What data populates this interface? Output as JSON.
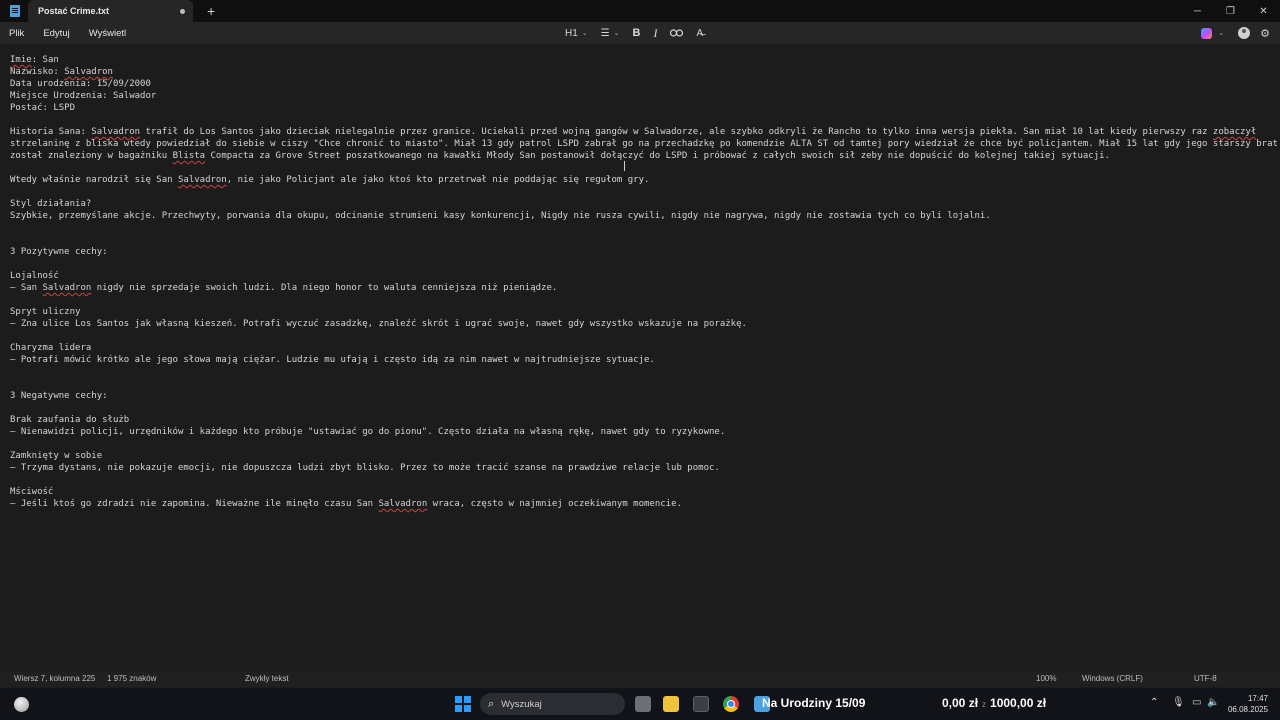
{
  "window": {
    "tab_title": "Postać Crime.txt",
    "new_tab": "+",
    "controls": [
      "─",
      "❐",
      "✕"
    ]
  },
  "menu": {
    "items": [
      "Plik",
      "Edytuj",
      "Wyświetl"
    ]
  },
  "toolbar": {
    "heading": "H1",
    "list": "☰",
    "bold": "B",
    "italic": "I",
    "link": "🔗",
    "clear_format": "A̶"
  },
  "document": {
    "lines": [
      [
        {
          "t": "Imie",
          "s": true
        },
        {
          "t": ": San"
        }
      ],
      [
        {
          "t": "Nazwisko: "
        },
        {
          "t": "Salvadron",
          "s": true
        }
      ],
      [
        {
          "t": "Data urodzenia: 15/09/2000"
        }
      ],
      [
        {
          "t": "Miejsce Urodzenia: Salwador"
        }
      ],
      [
        {
          "t": "Postać: LSPD"
        }
      ],
      [],
      [
        {
          "t": "Historia Sana: "
        },
        {
          "t": "Salvadron",
          "s": true
        },
        {
          "t": " trafił do Los Santos jako dzieciak nielegalnie przez granice. Uciekali przed wojną gangów w Salwadorze, ale szybko odkryli że Rancho to tylko inna wersja piekła. San miał 10 lat kiedy pierwszy raz "
        },
        {
          "t": "zobaczył",
          "s": true
        }
      ],
      [
        {
          "t": "strzelaninę z bliska wtedy powiedział do siebie w ciszy \"Chce chronić to miasto\". Miał 13 gdy patrol LSPD zabrał go na przechadzkę po komendzie ALTA ST od tamtej pory wiedział że chce być policjantem. Miał 15 lat gdy jego starszy brat"
        }
      ],
      [
        {
          "t": "został znaleziony w bagażniku "
        },
        {
          "t": "Blista",
          "s": true
        },
        {
          "t": " Compacta za Grove Street poszatkowanego na kawałki Młody San postanowił dołączyć do LSPD i próbować z całych swoich sił zeby nie dopuścić do kolejnej takiej sytuacji."
        }
      ],
      [],
      [
        {
          "t": "Wtedy właśnie narodził się San "
        },
        {
          "t": "Salvadron",
          "s": true
        },
        {
          "t": ", nie jako Policjant ale jako ktoś kto przetrwał nie poddając się regułom gry."
        }
      ],
      [],
      [
        {
          "t": "Styl działania?"
        }
      ],
      [
        {
          "t": "Szybkie, przemyślane akcje. Przechwyty, porwania dla okupu, odcinanie strumieni kasy konkurencji, Nigdy nie rusza cywili, nigdy nie nagrywa, nigdy nie zostawia tych co byli lojalni."
        }
      ],
      [],
      [],
      [
        {
          "t": "3 Pozytywne cechy:"
        }
      ],
      [],
      [
        {
          "t": "Lojalność"
        }
      ],
      [
        {
          "t": "– San "
        },
        {
          "t": "Salvadron",
          "s": true
        },
        {
          "t": " nigdy nie sprzedaje swoich ludzi. Dla niego honor to waluta cenniejsza niż pieniądze."
        }
      ],
      [],
      [
        {
          "t": "Spryt uliczny"
        }
      ],
      [
        {
          "t": "– Zna ulice Los Santos jak własną kieszeń. Potrafi wyczuć zasadzkę, znaleźć skrót i ugrać swoje, nawet gdy wszystko wskazuje na porażkę."
        }
      ],
      [],
      [
        {
          "t": "Charyzma lidera"
        }
      ],
      [
        {
          "t": "– Potrafi mówić krótko ale jego słowa mają ciężar. Ludzie mu ufają i często idą za nim nawet w najtrudniejsze sytuacje."
        }
      ],
      [],
      [],
      [
        {
          "t": "3 Negatywne cechy:"
        }
      ],
      [],
      [
        {
          "t": "Brak zaufania do służb"
        }
      ],
      [
        {
          "t": "– Nienawidzi policji, urzędników i każdego kto próbuje \"ustawiać go do pionu\". Często działa na własną rękę, nawet gdy to ryzykowne."
        }
      ],
      [],
      [
        {
          "t": "Zamknięty w sobie"
        }
      ],
      [
        {
          "t": "– Trzyma dystans, nie pokazuje emocji, nie dopuszcza ludzi zbyt blisko. Przez to może tracić szanse na prawdziwe relacje lub pomoc."
        }
      ],
      [],
      [
        {
          "t": "Mściwość"
        }
      ],
      [
        {
          "t": "– Jeśli ktoś go zdradzi nie zapomina. Nieważne ile minęło czasu San "
        },
        {
          "t": "Salvadron",
          "s": true
        },
        {
          "t": " wraca, często w najmniej oczekiwanym momencie."
        }
      ]
    ]
  },
  "statusbar": {
    "position": "Wiersz 7, kolumna 225",
    "chars": "1 975 znaków",
    "format": "Zwykły tekst",
    "zoom": "100%",
    "line_ending": "Windows (CRLF)",
    "encoding": "UTF-8"
  },
  "taskbar": {
    "search_placeholder": "Wyszukaj",
    "active_title": "Na Urodziny 15/09",
    "money_current": "0,00 zł",
    "money_separator": "z",
    "money_goal": "1000,00 zł",
    "time": "17:47",
    "date": "06.08.2025"
  },
  "colors": {
    "accent": "#2a9bff",
    "spell_error": "#d04040",
    "editor_bg": "#1c1c1c"
  }
}
